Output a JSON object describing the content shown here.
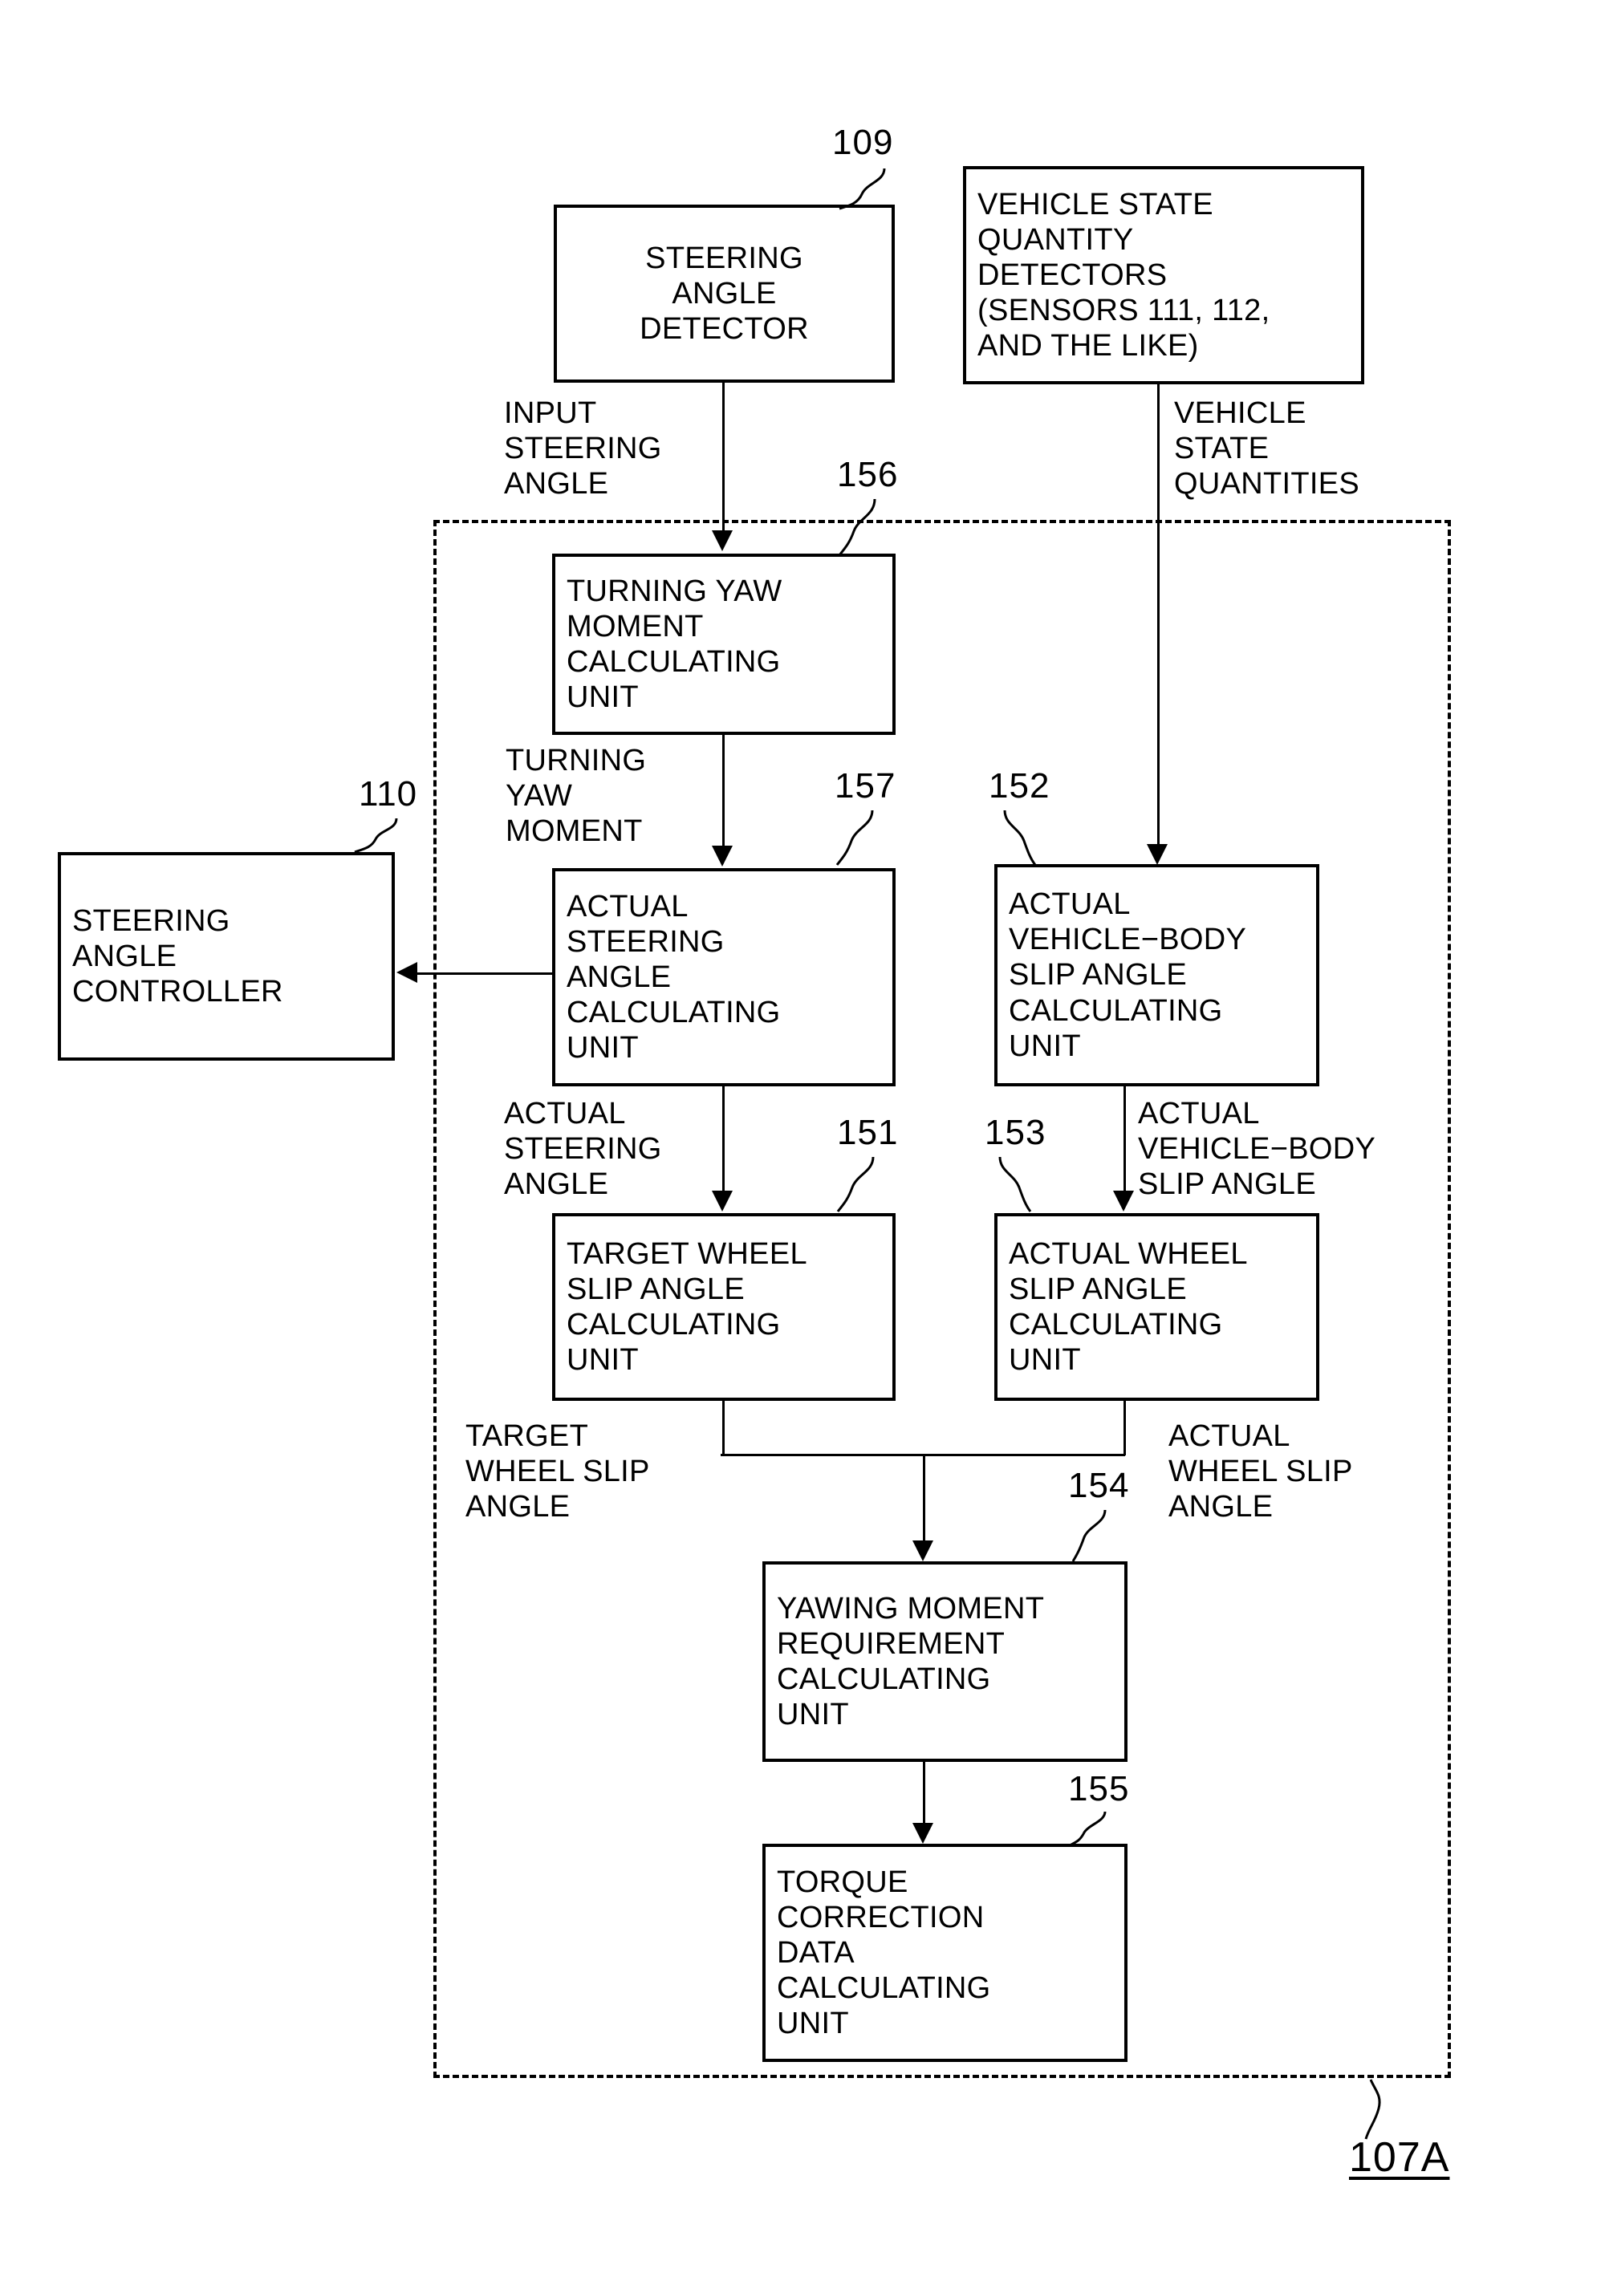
{
  "figure": {
    "label": "107A",
    "enclosure_name": "control-unit-boundary"
  },
  "blocks": [
    {
      "id": "steering-angle-detector",
      "ref": "109",
      "lines": [
        "STEERING",
        "ANGLE",
        "DETECTOR"
      ]
    },
    {
      "id": "vehicle-state-quantity-detectors",
      "ref": "",
      "lines": [
        "VEHICLE STATE",
        "QUANTITY",
        "DETECTORS",
        "(SENSORS 111, 112,",
        "AND THE LIKE)"
      ]
    },
    {
      "id": "steering-angle-controller",
      "ref": "110",
      "lines": [
        "STEERING",
        "ANGLE",
        "CONTROLLER"
      ]
    },
    {
      "id": "turning-yaw-moment-calculating-unit",
      "ref": "156",
      "lines": [
        "TURNING YAW",
        "MOMENT",
        "CALCULATING",
        "UNIT"
      ]
    },
    {
      "id": "actual-steering-angle-calculating-unit",
      "ref": "157",
      "lines": [
        "ACTUAL",
        "STEERING",
        "ANGLE",
        "CALCULATING",
        "UNIT"
      ]
    },
    {
      "id": "actual-vehicle-body-slip-angle-calculating-unit",
      "ref": "152",
      "lines": [
        "ACTUAL",
        "VEHICLE−BODY",
        "SLIP ANGLE",
        "CALCULATING",
        "UNIT"
      ]
    },
    {
      "id": "target-wheel-slip-angle-calculating-unit",
      "ref": "151",
      "lines": [
        "TARGET WHEEL",
        "SLIP ANGLE",
        "CALCULATING",
        "UNIT"
      ]
    },
    {
      "id": "actual-wheel-slip-angle-calculating-unit",
      "ref": "153",
      "lines": [
        "ACTUAL WHEEL",
        "SLIP ANGLE",
        "CALCULATING",
        "UNIT"
      ]
    },
    {
      "id": "yawing-moment-requirement-calculating-unit",
      "ref": "154",
      "lines": [
        "YAWING MOMENT",
        "REQUIREMENT",
        "CALCULATING",
        "UNIT"
      ]
    },
    {
      "id": "torque-correction-data-calculating-unit",
      "ref": "155",
      "lines": [
        "TORQUE",
        "CORRECTION",
        "DATA",
        "CALCULATING",
        "UNIT"
      ]
    }
  ],
  "signal_labels": [
    {
      "id": "input-steering-angle",
      "lines": [
        "INPUT",
        "STEERING",
        "ANGLE"
      ]
    },
    {
      "id": "vehicle-state-quantities",
      "lines": [
        "VEHICLE",
        "STATE",
        "QUANTITIES"
      ]
    },
    {
      "id": "turning-yaw-moment",
      "lines": [
        "TURNING",
        "YAW",
        "MOMENT"
      ]
    },
    {
      "id": "actual-steering-angle",
      "lines": [
        "ACTUAL",
        "STEERING",
        "ANGLE"
      ]
    },
    {
      "id": "actual-vehicle-body-slip-angle",
      "lines": [
        "ACTUAL",
        "VEHICLE−BODY",
        "SLIP ANGLE"
      ]
    },
    {
      "id": "target-wheel-slip-angle",
      "lines": [
        "TARGET",
        "WHEEL SLIP",
        "ANGLE"
      ]
    },
    {
      "id": "actual-wheel-slip-angle",
      "lines": [
        "ACTUAL",
        "WHEEL SLIP",
        "ANGLE"
      ]
    }
  ],
  "text": {
    "b109_l1": "STEERING",
    "b109_l2": "ANGLE",
    "b109_l3": "DETECTOR",
    "bvs_l1": "VEHICLE STATE",
    "bvs_l2": "QUANTITY",
    "bvs_l3": "DETECTORS",
    "bvs_l4": "(SENSORS 111, 112,",
    "bvs_l5": "AND THE LIKE)",
    "b110_l1": "STEERING",
    "b110_l2": "ANGLE",
    "b110_l3": "CONTROLLER",
    "b156_l1": "TURNING YAW",
    "b156_l2": "MOMENT",
    "b156_l3": "CALCULATING",
    "b156_l4": "UNIT",
    "b157_l1": "ACTUAL",
    "b157_l2": "STEERING",
    "b157_l3": "ANGLE",
    "b157_l4": "CALCULATING",
    "b157_l5": "UNIT",
    "b152_l1": "ACTUAL",
    "b152_l2": "VEHICLE−BODY",
    "b152_l3": "SLIP ANGLE",
    "b152_l4": "CALCULATING",
    "b152_l5": "UNIT",
    "b151_l1": "TARGET WHEEL",
    "b151_l2": "SLIP ANGLE",
    "b151_l3": "CALCULATING",
    "b151_l4": "UNIT",
    "b153_l1": "ACTUAL WHEEL",
    "b153_l2": "SLIP ANGLE",
    "b153_l3": "CALCULATING",
    "b153_l4": "UNIT",
    "b154_l1": "YAWING MOMENT",
    "b154_l2": "REQUIREMENT",
    "b154_l3": "CALCULATING",
    "b154_l4": "UNIT",
    "b155_l1": "TORQUE",
    "b155_l2": "CORRECTION",
    "b155_l3": "DATA",
    "b155_l4": "CALCULATING",
    "b155_l5": "UNIT",
    "sig_input_steering_angle": "INPUT\nSTEERING\nANGLE",
    "sig_vehicle_state_quantities": "VEHICLE\nSTATE\nQUANTITIES",
    "sig_turning_yaw_moment": "TURNING\nYAW\nMOMENT",
    "sig_actual_steering_angle": "ACTUAL\nSTEERING\nANGLE",
    "sig_actual_vb_slip_angle": "ACTUAL\nVEHICLE−BODY\nSLIP ANGLE",
    "sig_target_wheel_slip_angle": "TARGET\nWHEEL SLIP\nANGLE",
    "sig_actual_wheel_slip_angle": "ACTUAL\nWHEEL SLIP\nANGLE"
  },
  "refs": {
    "r109": "109",
    "r110": "110",
    "r151": "151",
    "r152": "152",
    "r153": "153",
    "r154": "154",
    "r155": "155",
    "r156": "156",
    "r157": "157",
    "r107A": "107A"
  },
  "colors": {
    "stroke": "#000000",
    "background": "#ffffff"
  }
}
